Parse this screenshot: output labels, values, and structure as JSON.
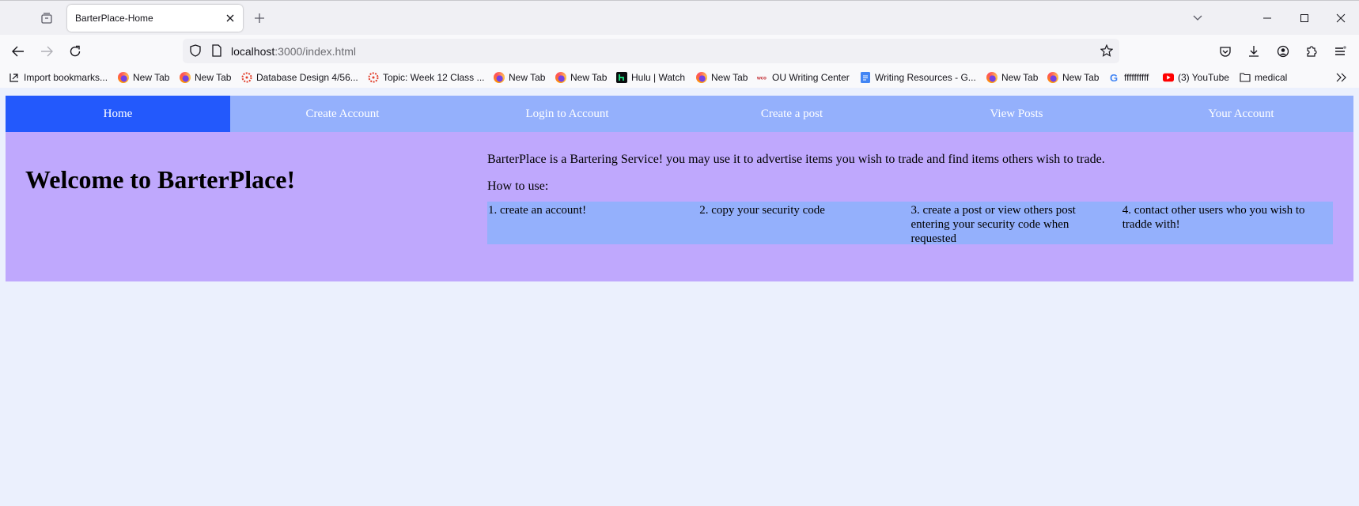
{
  "browser": {
    "tab_title": "BarterPlace-Home",
    "url_host": "localhost",
    "url_rest": ":3000/index.html",
    "bookmarks": [
      {
        "label": "Import bookmarks...",
        "icon": "import-icon"
      },
      {
        "label": "New Tab",
        "icon": "firefox-icon"
      },
      {
        "label": "New Tab",
        "icon": "firefox-icon"
      },
      {
        "label": "Database Design 4/56...",
        "icon": "canvas-icon"
      },
      {
        "label": "Topic: Week 12 Class ...",
        "icon": "canvas-icon"
      },
      {
        "label": "New Tab",
        "icon": "firefox-icon"
      },
      {
        "label": "New Tab",
        "icon": "firefox-icon"
      },
      {
        "label": "Hulu | Watch",
        "icon": "hulu-icon"
      },
      {
        "label": "New Tab",
        "icon": "firefox-icon"
      },
      {
        "label": "OU Writing Center",
        "icon": "wco-icon"
      },
      {
        "label": "Writing Resources - G...",
        "icon": "google-docs-icon"
      },
      {
        "label": "New Tab",
        "icon": "firefox-icon"
      },
      {
        "label": "New Tab",
        "icon": "firefox-icon"
      },
      {
        "label": "ffffffffff",
        "icon": "google-icon"
      },
      {
        "label": "(3) YouTube",
        "icon": "youtube-icon"
      },
      {
        "label": "medical",
        "icon": "folder-icon"
      }
    ]
  },
  "site": {
    "nav": [
      {
        "label": "Home",
        "active": true
      },
      {
        "label": "Create Account",
        "active": false
      },
      {
        "label": "Login to Account",
        "active": false
      },
      {
        "label": "Create a post",
        "active": false
      },
      {
        "label": "View Posts",
        "active": false
      },
      {
        "label": "Your Account",
        "active": false
      }
    ],
    "hero_title": "Welcome to BarterPlace!",
    "description": "BarterPlace is a Bartering Service! you may use it to advertise items you wish to trade and find items others wish to trade.",
    "how_to_label": "How to use:",
    "steps": [
      "1. create an account!",
      "2. copy your security code",
      "3. create a post or view others post entering your security code when requested",
      "4. contact other users who you wish to tradde with!"
    ]
  },
  "colors": {
    "nav_bg": "#94b0fc",
    "nav_active": "#2359fc",
    "hero_bg": "#bfa8fd",
    "page_bg": "#ebf0fd"
  }
}
